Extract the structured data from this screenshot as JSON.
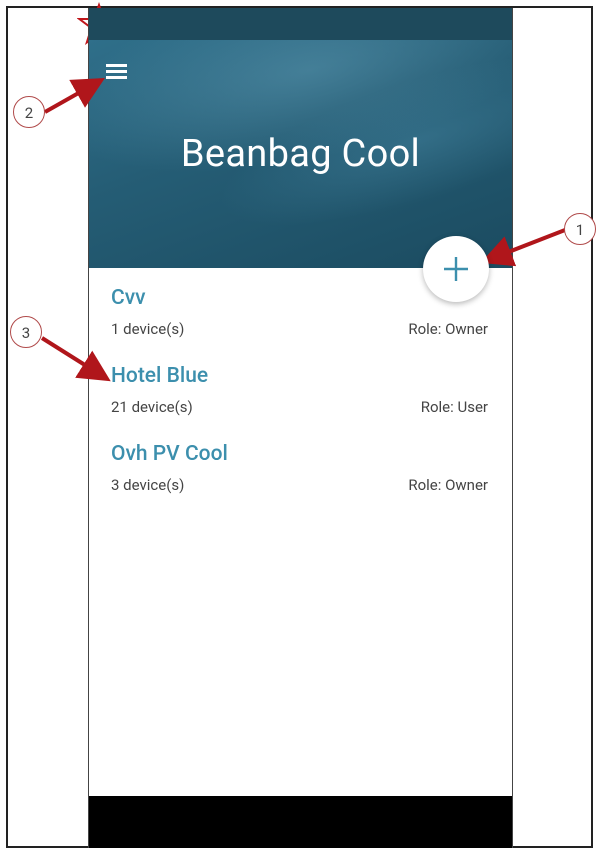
{
  "header": {
    "title": "Beanbag Cool",
    "colors": {
      "header_bg": "#255d75",
      "status_bar": "#1e4a5c",
      "accent": "#3c8fad"
    }
  },
  "icons": {
    "menu": "hamburger-menu-icon",
    "add": "plus-icon",
    "marker": "star-outline-icon"
  },
  "places": [
    {
      "name": "Cvv",
      "devices": "1 device(s)",
      "role": "Role: Owner"
    },
    {
      "name": "Hotel Blue",
      "devices": "21 device(s)",
      "role": "Role: User"
    },
    {
      "name": "Ovh PV Cool",
      "devices": "3 device(s)",
      "role": "Role: Owner"
    }
  ],
  "callouts": {
    "c1": "1",
    "c2": "2",
    "c3": "3"
  }
}
